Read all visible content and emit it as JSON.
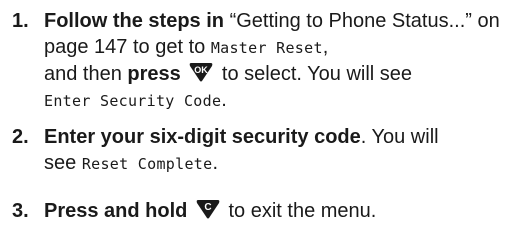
{
  "steps": [
    {
      "number": "1.",
      "a": "Follow the steps in",
      "b": " “Getting to Phone Status...” on page 147 to get to ",
      "c": "Master Reset",
      "d": ",",
      "e": "and then ",
      "f": "press",
      "g": " to select. You will see",
      "h": "Enter Security Code",
      "i": ".",
      "icon": "ok-key-icon"
    },
    {
      "number": "2.",
      "a": "Enter your six-digit security code",
      "b": ". You will",
      "c": "see ",
      "d": "Reset Complete",
      "e": "."
    },
    {
      "number": "3.",
      "a": "Press and hold",
      "b": " to exit the menu.",
      "icon": "c-key-icon"
    }
  ],
  "icons": {
    "ok_label": "OK",
    "c_label": "C",
    "key_color": "#1a1a1a"
  }
}
